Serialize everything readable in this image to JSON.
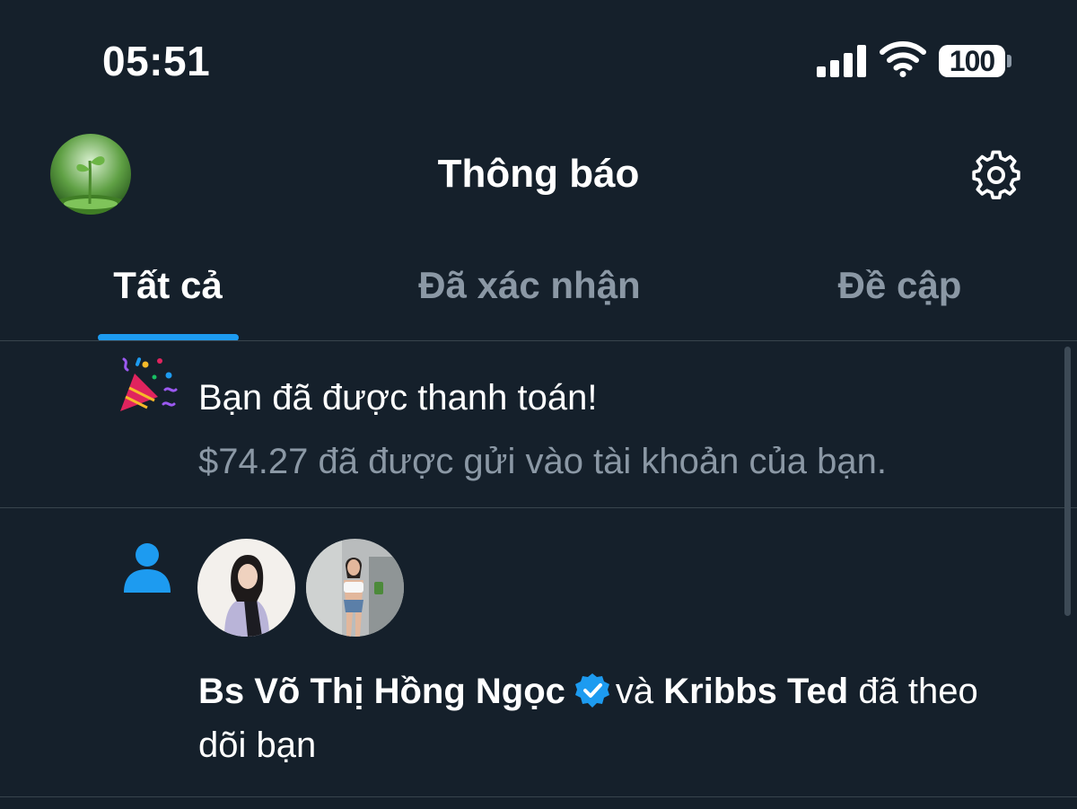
{
  "status_bar": {
    "time": "05:51",
    "battery": "100",
    "icons": [
      "signal-icon",
      "wifi-icon",
      "battery-icon"
    ]
  },
  "header": {
    "title": "Thông báo",
    "avatar": "profile-avatar-sprout",
    "settings_icon": "gear-icon"
  },
  "tabs": [
    {
      "label": "Tất cả",
      "active": true
    },
    {
      "label": "Đã xác nhận",
      "active": false
    },
    {
      "label": "Đề cập",
      "active": false
    }
  ],
  "notifications": [
    {
      "type": "payout",
      "icon": "party-popper-icon",
      "title": "Bạn đã được thanh toán!",
      "subtitle": "$74.27 đã được gửi vào tài khoản của bạn."
    },
    {
      "type": "follow",
      "icon": "person-icon",
      "user1": "Bs Võ Thị Hồng Ngọc",
      "user1_verified": true,
      "connector": "và",
      "user2": "Kribbs Ted",
      "action": "đã theo dõi bạn"
    }
  ],
  "colors": {
    "background": "#15202b",
    "accent": "#1d9bf0",
    "muted_text": "#8b98a5",
    "divider": "#38444d"
  }
}
